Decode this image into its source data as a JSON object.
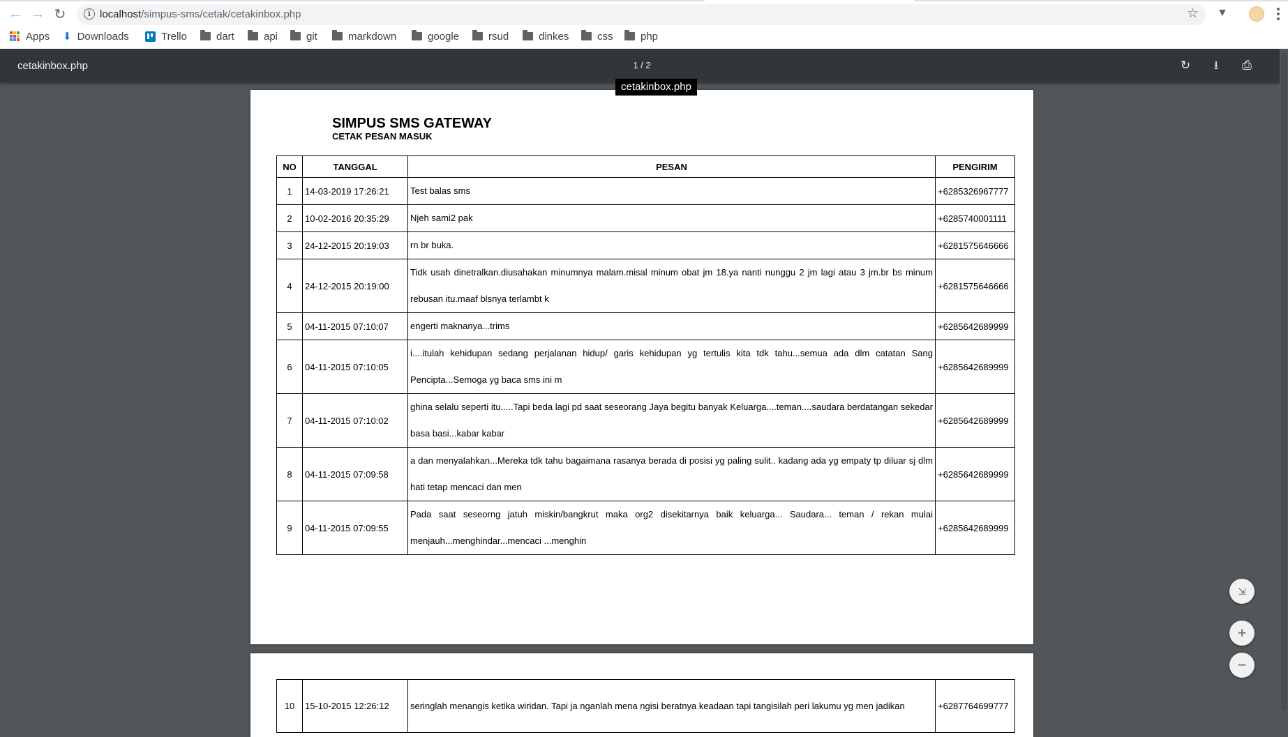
{
  "browser": {
    "url_host": "localhost",
    "url_path": "/simpus-sms/cetak/cetakinbox.php",
    "bookmarks": [
      {
        "label": "Apps",
        "icon": "apps-icon"
      },
      {
        "label": "Downloads",
        "icon": "download-icon"
      },
      {
        "label": "Trello",
        "icon": "trello-icon"
      },
      {
        "label": "dart",
        "icon": "folder-icon"
      },
      {
        "label": "api",
        "icon": "folder-icon"
      },
      {
        "label": "git",
        "icon": "folder-icon"
      },
      {
        "label": "markdown",
        "icon": "folder-icon"
      },
      {
        "label": "google",
        "icon": "folder-icon"
      },
      {
        "label": "rsud",
        "icon": "folder-icon"
      },
      {
        "label": "dinkes",
        "icon": "folder-icon"
      },
      {
        "label": "css",
        "icon": "folder-icon"
      },
      {
        "label": "php",
        "icon": "folder-icon"
      }
    ]
  },
  "viewer": {
    "file_name": "cetakinbox.php",
    "page_indicator": "1 / 2",
    "tooltip": "cetakinbox.php"
  },
  "document": {
    "title": "SIMPUS SMS GATEWAY",
    "subtitle": "CETAK PESAN MASUK",
    "columns": [
      "NO",
      "TANGGAL",
      "PESAN",
      "PENGIRIM"
    ],
    "rows": [
      {
        "no": "1",
        "date": "14-03-2019 17:26:21",
        "message": "Test balas sms",
        "sender": "+6285326967777"
      },
      {
        "no": "2",
        "date": "10-02-2016 20:35:29",
        "message": "Njeh sami2 pak",
        "sender": "+6285740001111"
      },
      {
        "no": "3",
        "date": "24-12-2015 20:19:03",
        "message": "rn br buka.",
        "sender": "+6281575646666"
      },
      {
        "no": "4",
        "date": "24-12-2015 20:19:00",
        "message": "Tidk usah dinetralkan.diusahakan minumnya malam.misal minum obat jm 18.ya nanti nunggu 2 jm lagi atau 3 jm.br bs minum rebusan itu.maaf blsnya terlambt k",
        "sender": "+6281575646666"
      },
      {
        "no": "5",
        "date": "04-11-2015 07:10:07",
        "message": "engerti maknanya...trims",
        "sender": "+6285642689999"
      },
      {
        "no": "6",
        "date": "04-11-2015 07:10:05",
        "message": "i....itulah kehidupan sedang perjalanan hidup/ garis kehidupan yg tertulis kita tdk tahu...semua ada dlm catatan Sang Pencipta...Semoga yg baca sms ini m",
        "sender": "+6285642689999"
      },
      {
        "no": "7",
        "date": "04-11-2015 07:10:02",
        "message": "ghina selalu seperti itu.....Tapi beda lagi pd saat seseorang Jaya begitu banyak Keluarga....teman....saudara berdatangan sekedar basa basi...kabar kabar",
        "sender": "+6285642689999"
      },
      {
        "no": "8",
        "date": "04-11-2015 07:09:58",
        "message": "a dan menyalahkan...Mereka tdk tahu bagaimana rasanya berada di posisi yg paling sulit.. kadang ada yg empaty tp diluar sj dlm hati tetap mencaci dan men",
        "sender": "+6285642689999"
      },
      {
        "no": "9",
        "date": "04-11-2015 07:09:55",
        "message": "Pada saat seseorng jatuh miskin/bangkrut maka org2 disekitarnya baik keluarga... Saudara... teman / rekan mulai menjauh...menghindar...mencaci ...menghin",
        "sender": "+6285642689999"
      }
    ],
    "page2_rows": [
      {
        "no": "10",
        "date": "15-10-2015 12:26:12",
        "message": "seringlah menangis ketika wiridan. Tapi ja nganlah mena ngisi beratnya keadaan tapi tangisilah peri lakumu yg men jadikan",
        "sender": "+6287764699777"
      }
    ]
  }
}
